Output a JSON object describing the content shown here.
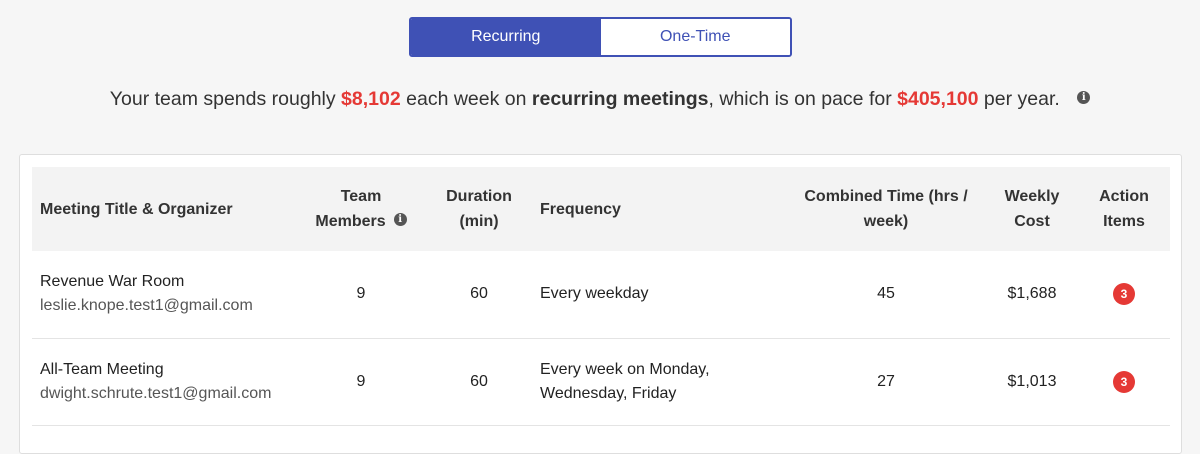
{
  "toggle": {
    "recurring_label": "Recurring",
    "onetime_label": "One-Time",
    "selected": "Recurring"
  },
  "summary": {
    "prefix": "Your team spends roughly",
    "weekly_cost": "$8,102",
    "middle1": "each week on",
    "meeting_type": "recurring meetings",
    "middle2": ", which is on pace for",
    "yearly_cost": "$405,100",
    "suffix": "per year.",
    "info_glyph": "i"
  },
  "table": {
    "headers": {
      "title": "Meeting Title & Organizer",
      "team": "Team Members",
      "duration": "Duration (min)",
      "frequency": "Frequency",
      "combined": "Combined Time (hrs / week)",
      "weekly": "Weekly Cost",
      "actions": "Action Items",
      "info_glyph": "i"
    },
    "rows": [
      {
        "title": "Revenue War Room",
        "organizer": "leslie.knope.test1@gmail.com",
        "team_members": "9",
        "duration": "60",
        "frequency": "Every weekday",
        "combined_time": "45",
        "weekly_cost": "$1,688",
        "action_items": "3"
      },
      {
        "title": "All-Team Meeting",
        "organizer": "dwight.schrute.test1@gmail.com",
        "team_members": "9",
        "duration": "60",
        "frequency": "Every week on Monday, Wednesday, Friday",
        "combined_time": "27",
        "weekly_cost": "$1,013",
        "action_items": "3"
      }
    ]
  },
  "colors": {
    "accent": "#3f51b5",
    "money": "#e53935",
    "badge": "#e53935",
    "background": "#f6f6f6"
  },
  "icons": {
    "info": "info-circle-icon"
  }
}
